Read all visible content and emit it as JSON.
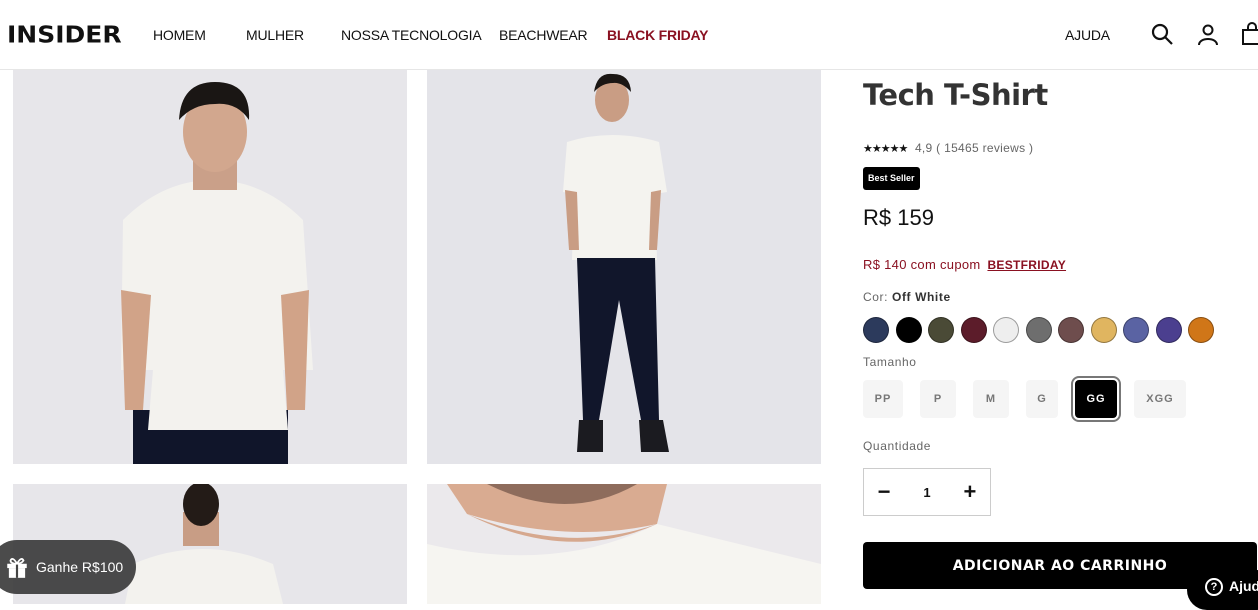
{
  "header": {
    "logo": "INSIDER",
    "nav": [
      "HOMEM",
      "MULHER",
      "NOSSA TECNOLOGIA",
      "BEACHWEAR",
      "BLACK FRIDAY"
    ],
    "help": "AJUDA",
    "icons": [
      "search-icon",
      "user-icon",
      "bag-icon"
    ]
  },
  "product": {
    "title": "Tech T-Shirt",
    "stars": "★★★★★",
    "rating": "4,9 ( 15465 reviews )",
    "badge": "Best Seller",
    "price": "R$ 159",
    "coupon_text": "R$ 140 com cupom",
    "coupon_code": "BESTFRIDAY",
    "color_label": "Cor:",
    "color_value": "Off White",
    "colors": [
      "#2c3a5c",
      "#000000",
      "#4a4a36",
      "#5c1c2a",
      "#eeeeee",
      "#6e6e6e",
      "#6e4d4d",
      "#e0b560",
      "#5a63a3",
      "#4b3f8f",
      "#d07618"
    ],
    "size_label": "Tamanho",
    "sizes": [
      "PP",
      "P",
      "M",
      "G",
      "GG",
      "XGG"
    ],
    "selected_size": "GG",
    "qty_label": "Quantidade",
    "qty_minus": "−",
    "qty_value": "1",
    "qty_plus": "+",
    "cart_button": "ADICIONAR AO CARRINHO"
  },
  "promo": {
    "gift_label": "Ganhe R$100",
    "help_label": "Ajuda"
  }
}
